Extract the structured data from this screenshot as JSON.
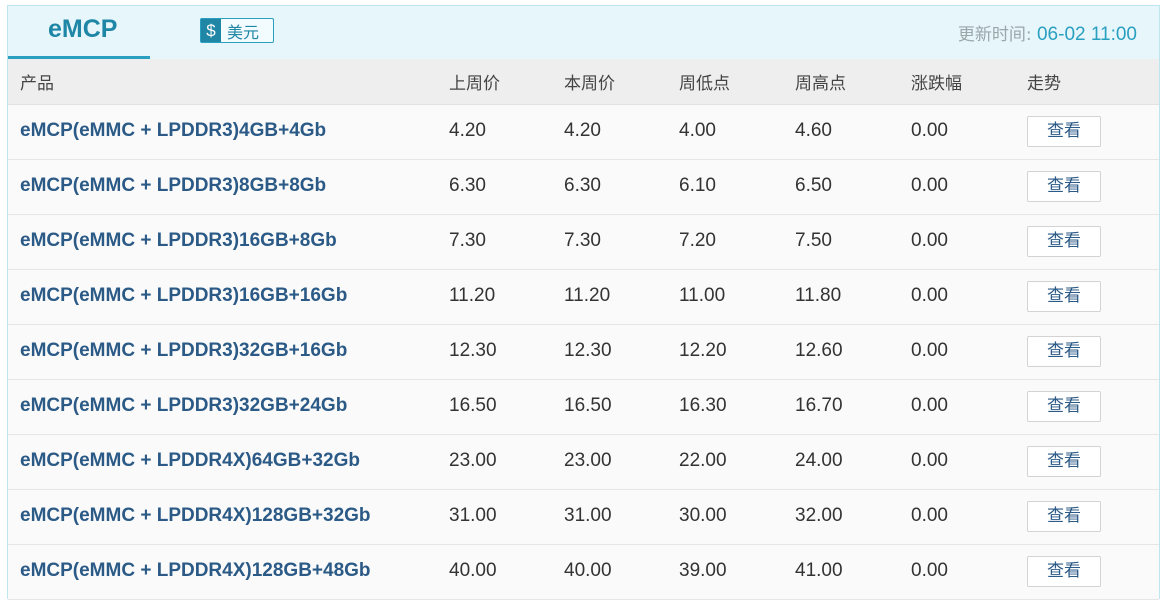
{
  "tab": {
    "label": "eMCP"
  },
  "currency": {
    "symbol": "$",
    "label": "美元"
  },
  "update": {
    "label": "更新时间:",
    "time": "06-02 11:00"
  },
  "table": {
    "headers": [
      "产品",
      "上周价",
      "本周价",
      "周低点",
      "周高点",
      "涨跌幅",
      "走势"
    ],
    "view_label": "查看",
    "rows": [
      {
        "name": "eMCP(eMMC + LPDDR3)4GB+4Gb",
        "last_week": "4.20",
        "this_week": "4.20",
        "low": "4.00",
        "high": "4.60",
        "change": "0.00"
      },
      {
        "name": "eMCP(eMMC + LPDDR3)8GB+8Gb",
        "last_week": "6.30",
        "this_week": "6.30",
        "low": "6.10",
        "high": "6.50",
        "change": "0.00"
      },
      {
        "name": "eMCP(eMMC + LPDDR3)16GB+8Gb",
        "last_week": "7.30",
        "this_week": "7.30",
        "low": "7.20",
        "high": "7.50",
        "change": "0.00"
      },
      {
        "name": "eMCP(eMMC + LPDDR3)16GB+16Gb",
        "last_week": "11.20",
        "this_week": "11.20",
        "low": "11.00",
        "high": "11.80",
        "change": "0.00"
      },
      {
        "name": "eMCP(eMMC + LPDDR3)32GB+16Gb",
        "last_week": "12.30",
        "this_week": "12.30",
        "low": "12.20",
        "high": "12.60",
        "change": "0.00"
      },
      {
        "name": "eMCP(eMMC + LPDDR3)32GB+24Gb",
        "last_week": "16.50",
        "this_week": "16.50",
        "low": "16.30",
        "high": "16.70",
        "change": "0.00"
      },
      {
        "name": "eMCP(eMMC + LPDDR4X)64GB+32Gb",
        "last_week": "23.00",
        "this_week": "23.00",
        "low": "22.00",
        "high": "24.00",
        "change": "0.00"
      },
      {
        "name": "eMCP(eMMC + LPDDR4X)128GB+32Gb",
        "last_week": "31.00",
        "this_week": "31.00",
        "low": "30.00",
        "high": "32.00",
        "change": "0.00"
      },
      {
        "name": "eMCP(eMMC + LPDDR4X)128GB+48Gb",
        "last_week": "40.00",
        "this_week": "40.00",
        "low": "39.00",
        "high": "41.00",
        "change": "0.00"
      }
    ]
  }
}
